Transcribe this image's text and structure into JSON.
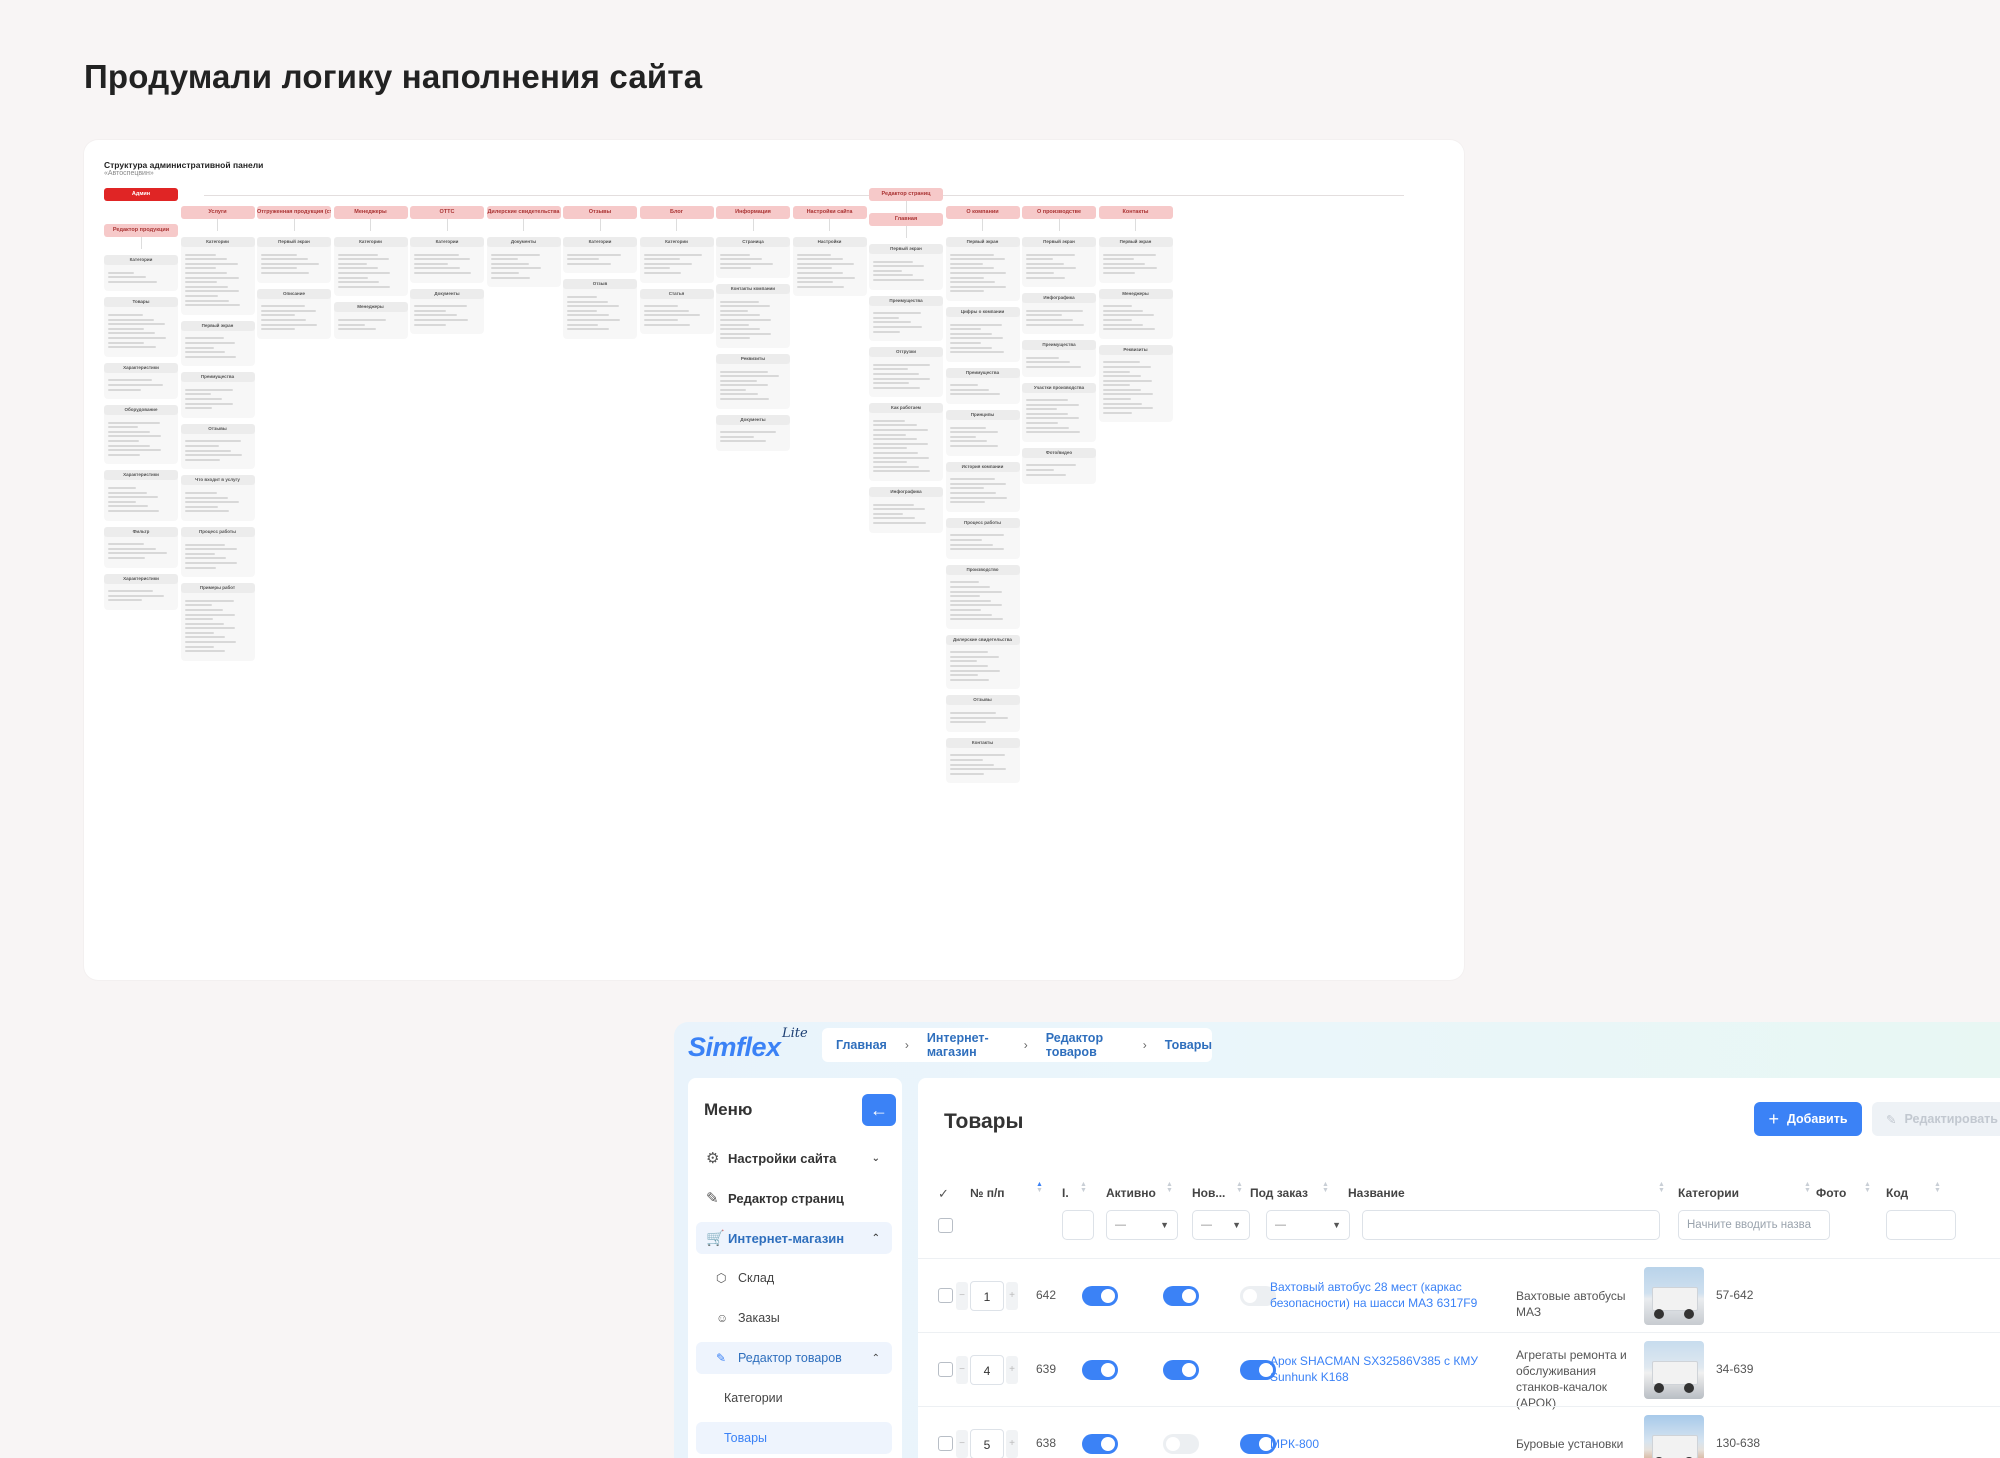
{
  "page": {
    "title": "Продумали логику наполнения сайта"
  },
  "sitemap": {
    "title": "Структура административной панели",
    "subtitle": "«Автоспецвин»",
    "root": "Админ",
    "columns": [
      {
        "head": "Редактор продукции",
        "boxes": [
          "Категории",
          "Товары",
          "Характеристики",
          "Оборудование",
          "Характеристики",
          "Фильтр",
          "Характеристики"
        ]
      },
      {
        "head": "Услуги",
        "boxes": [
          "Категории",
          "Первый экран",
          "Преимущества",
          "Отзывы",
          "Что входит в услугу",
          "Процесс работы",
          "Примеры работ"
        ]
      },
      {
        "head": "Отгруженная продукция (страница)",
        "boxes": [
          "Первый экран",
          "Описание"
        ]
      },
      {
        "head": "Менеджеры",
        "boxes": [
          "Категории",
          "Менеджеры"
        ]
      },
      {
        "head": "ОТТС",
        "boxes": [
          "Категории",
          "Документы"
        ]
      },
      {
        "head": "Дилерские свидетельства",
        "boxes": [
          "Документы"
        ]
      },
      {
        "head": "Отзывы",
        "boxes": [
          "Категории",
          "Отзыв"
        ]
      },
      {
        "head": "Блог",
        "boxes": [
          "Категории",
          "Статья"
        ]
      },
      {
        "head": "Информация",
        "boxes": [
          "Страница",
          "Контакты компании",
          "Реквизиты",
          "Документы"
        ]
      },
      {
        "head": "Настройки сайта",
        "boxes": [
          "Настройки"
        ]
      },
      {
        "head": "Главная",
        "top": "Редактор страниц",
        "boxes": [
          "Первый экран",
          "Преимущества",
          "Отгрузки",
          "Как работаем",
          "Инфографика"
        ]
      },
      {
        "head": "О компании",
        "boxes": [
          "Первый экран",
          "Цифры о компании",
          "Преимущества",
          "Принципы",
          "История компании",
          "Процесс работы",
          "Производство",
          "Дилерские свидетельства",
          "Отзывы",
          "Контакты"
        ]
      },
      {
        "head": "О производстве",
        "boxes": [
          "Первый экран",
          "Инфографика",
          "Преимущества",
          "Участки производства",
          "Фото/видео"
        ]
      },
      {
        "head": "Контакты",
        "boxes": [
          "Первый экран",
          "Менеджеры",
          "Реквизиты"
        ]
      }
    ]
  },
  "admin": {
    "logo": "Simflex",
    "logo_script": "Lite",
    "breadcrumbs": [
      "Главная",
      "Интернет-магазин",
      "Редактор товаров",
      "Товары"
    ],
    "menu": {
      "title": "Меню",
      "items": [
        {
          "label": "Настройки сайта",
          "icon": "⚙"
        },
        {
          "label": "Редактор страниц",
          "icon": "✎"
        },
        {
          "label": "Интернет-магазин",
          "icon": "🛒"
        },
        {
          "label": "Склад",
          "icon": "⬡"
        },
        {
          "label": "Заказы",
          "icon": "☺"
        },
        {
          "label": "Редактор товаров",
          "icon": "✎"
        },
        {
          "label": "Категории"
        },
        {
          "label": "Товары"
        }
      ]
    },
    "content": {
      "title": "Товары",
      "add_label": "Добавить",
      "edit_label": "Редактировать",
      "columns": [
        "№ п/п",
        "I.",
        "Активно",
        "Нов...",
        "Под заказ",
        "Название",
        "Категории",
        "Фото",
        "Код"
      ],
      "filter_placeholder_category": "Начните вводить назва",
      "filter_select_empty": "—",
      "rows": [
        {
          "order": "1",
          "id": "642",
          "active": true,
          "new": true,
          "preorder": false,
          "name": "Вахтовый автобус 28 мест (каркас безопасности) на шасси МАЗ 6317F9",
          "category": "Вахтовые автобусы МАЗ",
          "code": "57-642"
        },
        {
          "order": "4",
          "id": "639",
          "active": true,
          "new": true,
          "preorder": true,
          "name": "Арок SHACMAN SX32586V385 с КМУ Sunhunk K168",
          "category": "Агрегаты ремонта и обслуживания станков-качалок (АРОК)",
          "code": "34-639"
        },
        {
          "order": "5",
          "id": "638",
          "active": true,
          "new": false,
          "preorder": true,
          "name": "МРК-800",
          "category": "Буровые установки",
          "code": "130-638"
        }
      ]
    },
    "colors": {
      "accent": "#3b82f6",
      "root_red": "#e02525",
      "head_pink": "#f6c9c9"
    }
  }
}
